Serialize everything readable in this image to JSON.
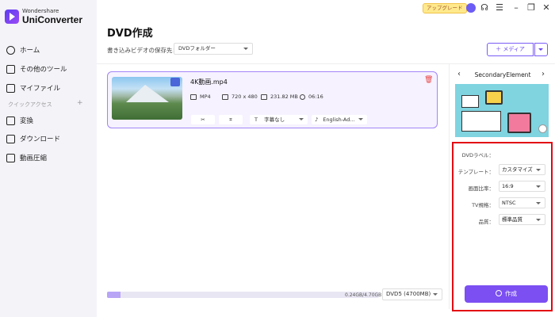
{
  "app": {
    "brand": "Wondershare",
    "product": "UniConverter",
    "upgrade_label": "アップグレード"
  },
  "sidebar": {
    "items": [
      {
        "label": "ホーム",
        "icon": "home-icon"
      },
      {
        "label": "その他のツール",
        "icon": "tools-icon"
      },
      {
        "label": "マイファイル",
        "icon": "file-icon"
      }
    ],
    "section_label": "クイックアクセス",
    "section_plus": "+",
    "quick_items": [
      {
        "label": "変換",
        "icon": "convert-icon"
      },
      {
        "label": "ダウンロード",
        "icon": "download-icon"
      },
      {
        "label": "動画圧縮",
        "icon": "compress-icon"
      }
    ]
  },
  "main": {
    "title": "DVD作成",
    "save_label": "書き込みビデオの保存先：",
    "save_value": "DVDフォルダー",
    "media_button": "＋ メディア"
  },
  "video": {
    "file_name": "4K動画.mp4",
    "format": "MP4",
    "resolution": "720 x 480",
    "size": "231.82 MB",
    "duration": "06:16",
    "subtitle": "字幕なし",
    "audio": "English-Ad..."
  },
  "footer": {
    "progress_fraction": 0.05,
    "progress_text": "0.24GB/4.70GB",
    "disc_type": "DVD5 (4700MB)"
  },
  "template": {
    "name": "SecondaryElement",
    "prev": "‹",
    "next": "›"
  },
  "settings": {
    "dvd_label": "DVDラベル：",
    "template_label": "テンプレート：",
    "template_value": "カスタマイズ",
    "aspect_label": "画面比率：",
    "aspect_value": "16:9",
    "tv_label": "TV規格：",
    "tv_value": "NTSC",
    "quality_label": "品質：",
    "quality_value": "標準品質",
    "create_button": "作成"
  },
  "colors": {
    "accent": "#7b4ff2",
    "highlight_box": "#e30613"
  }
}
